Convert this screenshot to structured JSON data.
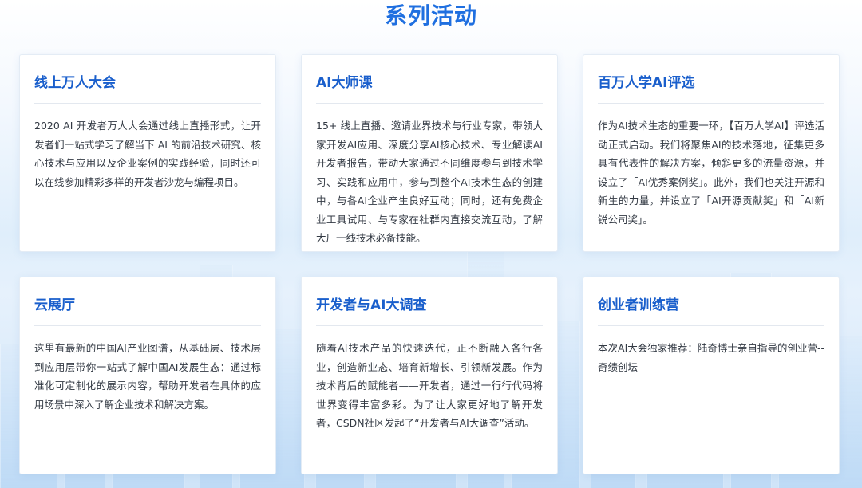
{
  "section": {
    "title": "系列活动"
  },
  "cards": [
    {
      "title": "线上万人大会",
      "body": "2020 AI 开发者万人大会通过线上直播形式，让开发者们一站式学习了解当下 AI 的前沿技术研究、核心技术与应用以及企业案例的实践经验，同时还可以在线参加精彩多样的开发者沙龙与编程项目。"
    },
    {
      "title": "AI大师课",
      "body": "15+ 线上直播、邀请业界技术与行业专家，带领大家开发AI应用、深度分享AI核心技术、专业解读AI开发者报告，带动大家通过不同维度参与到技术学习、实践和应用中，参与到整个AI技术生态的创建中，与各AI企业产生良好互动；同时，还有免费企业工具试用、与专家在社群内直接交流互动，了解大厂一线技术必备技能。"
    },
    {
      "title": "百万人学AI评选",
      "body": "作为AI技术生态的重要一环，【百万人学AI】评选活动正式启动。我们将聚焦AI的技术落地，征集更多具有代表性的解决方案，倾斜更多的流量资源，并设立了「AI优秀案例奖」。此外，我们也关注开源和新生的力量，并设立了「AI开源贡献奖」和「AI新锐公司奖」。"
    },
    {
      "title": "云展厅",
      "body": "这里有最新的中国AI产业图谱，从基础层、技术层到应用层带你一站式了解中国AI发展生态：通过标准化可定制化的展示内容，帮助开发者在具体的应用场景中深入了解企业技术和解决方案。"
    },
    {
      "title": "开发者与AI大调查",
      "body": "随着AI技术产品的快速迭代，正不断融入各行各业，创造新业态、培育新增长、引领新发展。作为技术背后的赋能者——开发者，通过一行行代码将世界变得丰富多彩。为了让大家更好地了解开发者，CSDN社区发起了“开发者与AI大调查”活动。"
    },
    {
      "title": "创业者训练营",
      "body": "本次AI大会独家推荐：陆奇博士亲自指导的创业营--奇绩创坛"
    }
  ]
}
